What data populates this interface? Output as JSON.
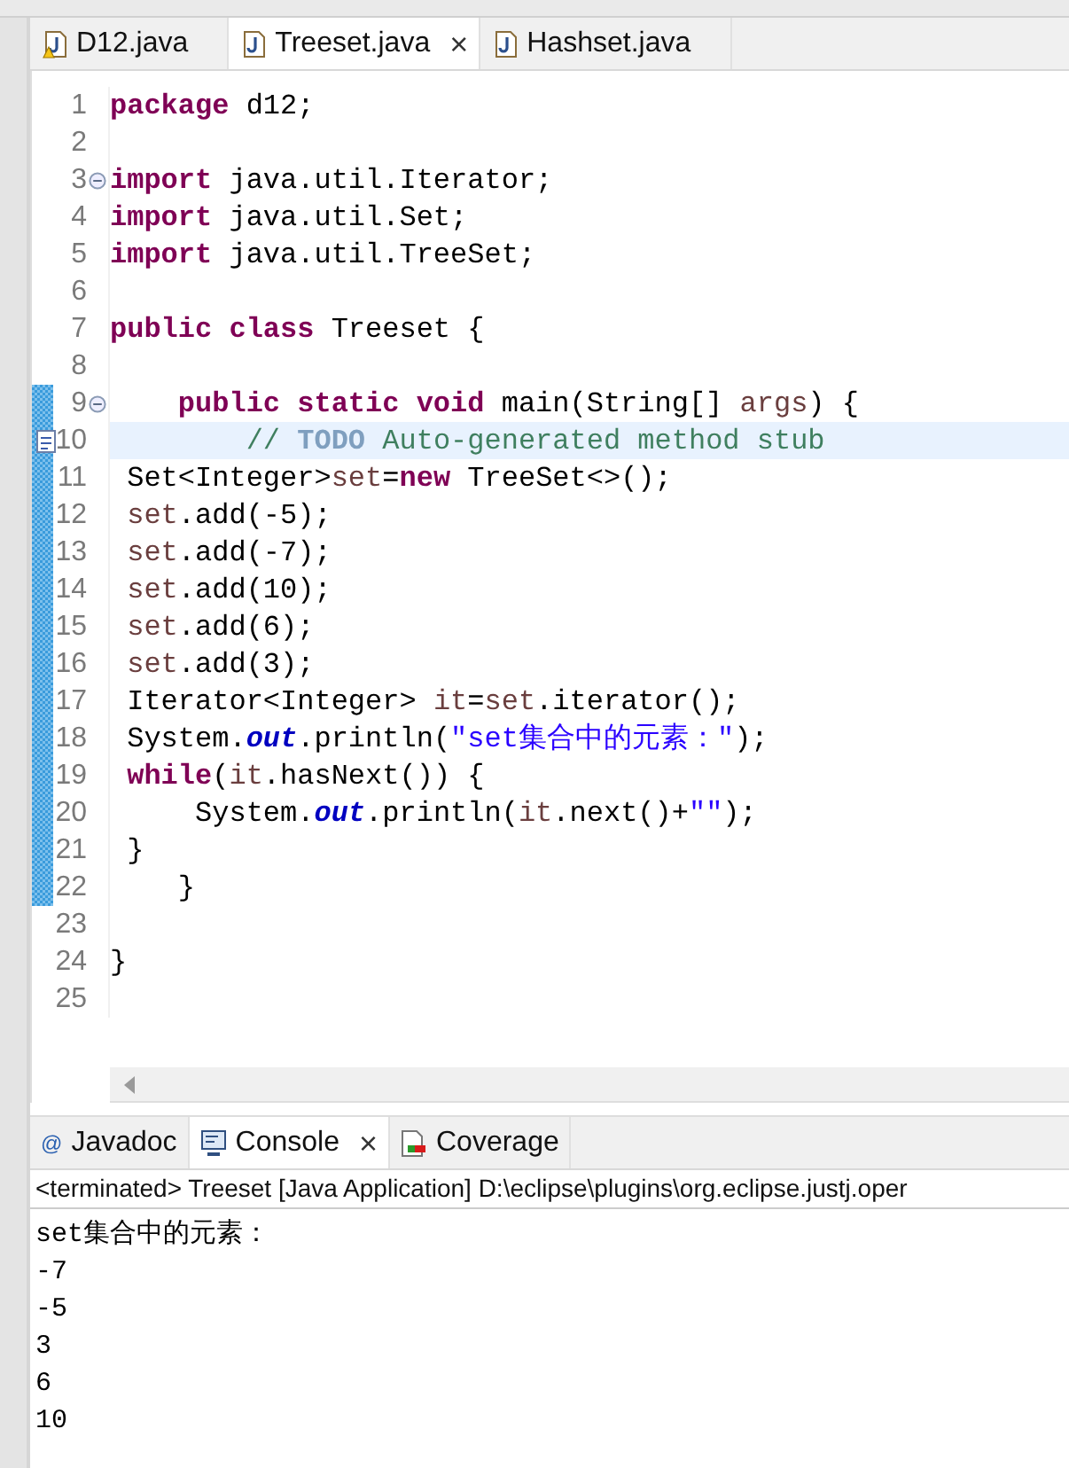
{
  "editor_tabs": [
    {
      "label": "D12.java",
      "selected": false,
      "warning": true
    },
    {
      "label": "Treeset.java",
      "selected": true,
      "warning": false,
      "close": "×"
    },
    {
      "label": "Hashset.java",
      "selected": false,
      "warning": false
    }
  ],
  "code_lines": [
    {
      "number": "1",
      "fold": false,
      "changed": false,
      "task": false,
      "current": false,
      "tokens": [
        {
          "kind": "keyword",
          "text": "package"
        },
        {
          "kind": "plain",
          "text": " d12;"
        }
      ]
    },
    {
      "number": "2",
      "fold": false,
      "changed": false,
      "task": false,
      "current": false
    },
    {
      "number": "3",
      "fold": true,
      "changed": false,
      "task": false,
      "current": false,
      "tokens": [
        {
          "kind": "keyword",
          "text": "import"
        },
        {
          "kind": "plain",
          "text": " java.util.Iterator;"
        }
      ]
    },
    {
      "number": "4",
      "fold": false,
      "changed": false,
      "task": false,
      "current": false,
      "tokens": [
        {
          "kind": "keyword",
          "text": "import"
        },
        {
          "kind": "plain",
          "text": " java.util.Set;"
        }
      ]
    },
    {
      "number": "5",
      "fold": false,
      "changed": false,
      "task": false,
      "current": false,
      "tokens": [
        {
          "kind": "keyword",
          "text": "import"
        },
        {
          "kind": "plain",
          "text": " java.util.TreeSet;"
        }
      ]
    },
    {
      "number": "6",
      "fold": false,
      "changed": false,
      "task": false,
      "current": false
    },
    {
      "number": "7",
      "fold": false,
      "changed": false,
      "task": false,
      "current": false,
      "tokens": [
        {
          "kind": "keyword",
          "text": "public class"
        },
        {
          "kind": "plain",
          "text": " Treeset {"
        }
      ]
    },
    {
      "number": "8",
      "fold": false,
      "changed": false,
      "task": false,
      "current": false
    },
    {
      "number": "9",
      "fold": true,
      "changed": true,
      "task": false,
      "current": false,
      "tokens": [
        {
          "kind": "keyword",
          "text": "    public static void"
        },
        {
          "kind": "plain",
          "text": " main(String[] "
        },
        {
          "kind": "variable",
          "text": "args"
        },
        {
          "kind": "plain",
          "text": ") {"
        }
      ]
    },
    {
      "number": "10",
      "fold": false,
      "changed": true,
      "task": true,
      "current": true,
      "tokens": [
        {
          "kind": "comment",
          "text": "        // "
        },
        {
          "kind": "todo",
          "text": "TODO"
        },
        {
          "kind": "comment",
          "text": " Auto-generated method stub"
        }
      ]
    },
    {
      "number": "11",
      "fold": false,
      "changed": true,
      "task": false,
      "current": false,
      "tokens": [
        {
          "kind": "plain",
          "text": " Set<Integer>"
        },
        {
          "kind": "variable",
          "text": "set"
        },
        {
          "kind": "plain",
          "text": "="
        },
        {
          "kind": "keyword",
          "text": "new"
        },
        {
          "kind": "plain",
          "text": " TreeSet<>();"
        }
      ]
    },
    {
      "number": "12",
      "fold": false,
      "changed": true,
      "task": false,
      "current": false,
      "tokens": [
        {
          "kind": "variable",
          "text": " set"
        },
        {
          "kind": "plain",
          "text": ".add(-5);"
        }
      ]
    },
    {
      "number": "13",
      "fold": false,
      "changed": true,
      "task": false,
      "current": false,
      "tokens": [
        {
          "kind": "variable",
          "text": " set"
        },
        {
          "kind": "plain",
          "text": ".add(-7);"
        }
      ]
    },
    {
      "number": "14",
      "fold": false,
      "changed": true,
      "task": false,
      "current": false,
      "tokens": [
        {
          "kind": "variable",
          "text": " set"
        },
        {
          "kind": "plain",
          "text": ".add(10);"
        }
      ]
    },
    {
      "number": "15",
      "fold": false,
      "changed": true,
      "task": false,
      "current": false,
      "tokens": [
        {
          "kind": "variable",
          "text": " set"
        },
        {
          "kind": "plain",
          "text": ".add(6);"
        }
      ]
    },
    {
      "number": "16",
      "fold": false,
      "changed": true,
      "task": false,
      "current": false,
      "tokens": [
        {
          "kind": "variable",
          "text": " set"
        },
        {
          "kind": "plain",
          "text": ".add(3);"
        }
      ]
    },
    {
      "number": "17",
      "fold": false,
      "changed": true,
      "task": false,
      "current": false,
      "tokens": [
        {
          "kind": "plain",
          "text": " Iterator<Integer> "
        },
        {
          "kind": "variable",
          "text": "it"
        },
        {
          "kind": "plain",
          "text": "="
        },
        {
          "kind": "variable",
          "text": "set"
        },
        {
          "kind": "plain",
          "text": ".iterator();"
        }
      ]
    },
    {
      "number": "18",
      "fold": false,
      "changed": true,
      "task": false,
      "current": false,
      "tokens": [
        {
          "kind": "plain",
          "text": " System."
        },
        {
          "kind": "field",
          "text": "out"
        },
        {
          "kind": "plain",
          "text": ".println("
        },
        {
          "kind": "string",
          "text": "\"set集合中的元素：\""
        },
        {
          "kind": "plain",
          "text": ");"
        }
      ]
    },
    {
      "number": "19",
      "fold": false,
      "changed": true,
      "task": false,
      "current": false,
      "tokens": [
        {
          "kind": "keyword",
          "text": " while"
        },
        {
          "kind": "plain",
          "text": "("
        },
        {
          "kind": "variable",
          "text": "it"
        },
        {
          "kind": "plain",
          "text": ".hasNext()) {"
        }
      ]
    },
    {
      "number": "20",
      "fold": false,
      "changed": true,
      "task": false,
      "current": false,
      "tokens": [
        {
          "kind": "plain",
          "text": "     System."
        },
        {
          "kind": "field",
          "text": "out"
        },
        {
          "kind": "plain",
          "text": ".println("
        },
        {
          "kind": "variable",
          "text": "it"
        },
        {
          "kind": "plain",
          "text": ".next()+"
        },
        {
          "kind": "string",
          "text": "\"\""
        },
        {
          "kind": "plain",
          "text": ");"
        }
      ]
    },
    {
      "number": "21",
      "fold": false,
      "changed": true,
      "task": false,
      "current": false,
      "tokens": [
        {
          "kind": "plain",
          "text": " }"
        }
      ]
    },
    {
      "number": "22",
      "fold": false,
      "changed": true,
      "task": false,
      "current": false,
      "tokens": [
        {
          "kind": "plain",
          "text": "    }"
        }
      ]
    },
    {
      "number": "23",
      "fold": false,
      "changed": false,
      "task": false,
      "current": false
    },
    {
      "number": "24",
      "fold": false,
      "changed": false,
      "task": false,
      "current": false,
      "tokens": [
        {
          "kind": "plain",
          "text": "}"
        }
      ]
    },
    {
      "number": "25",
      "fold": false,
      "changed": false,
      "task": false,
      "current": false
    }
  ],
  "panel_tabs": [
    {
      "label": "Javadoc",
      "kind": "javadoc",
      "selected": false,
      "icon_text": "@"
    },
    {
      "label": "Console",
      "kind": "console",
      "selected": true,
      "close": "×"
    },
    {
      "label": "Coverage",
      "kind": "coverage",
      "selected": false
    }
  ],
  "console": {
    "header": "<terminated> Treeset [Java Application] D:\\eclipse\\plugins\\org.eclipse.justj.oper",
    "lines": [
      "set集合中的元素：",
      "-7",
      "-5",
      "3",
      "6",
      "10"
    ]
  }
}
